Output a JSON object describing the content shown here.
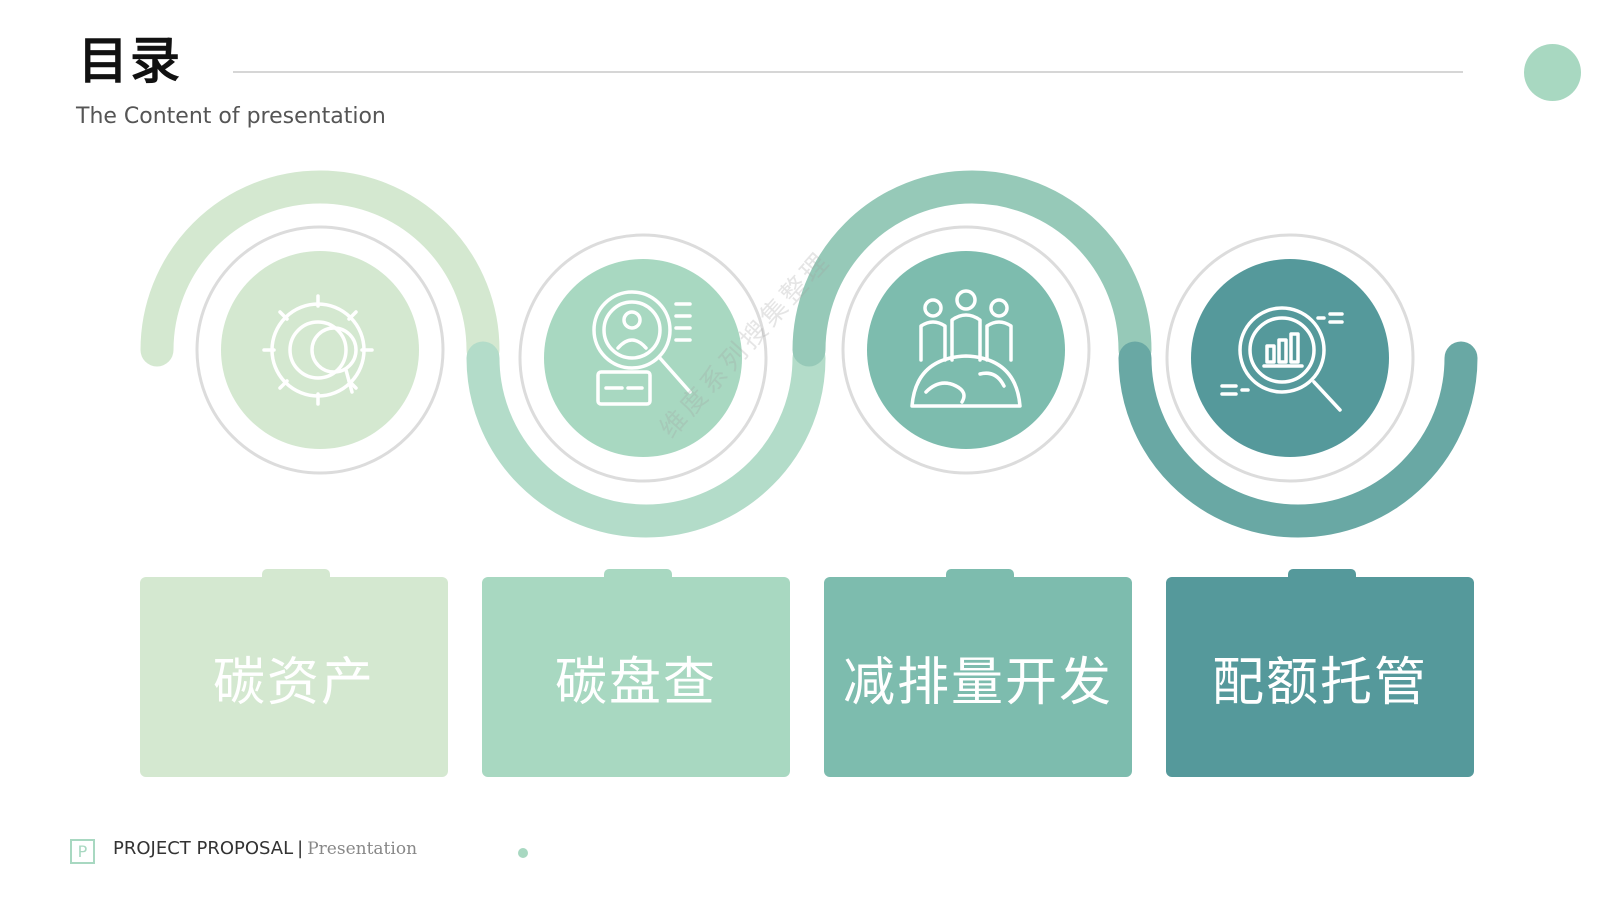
{
  "header": {
    "title": "目录",
    "subtitle": "The Content of presentation"
  },
  "items": [
    {
      "label": "碳资产",
      "icon": "gear-magnifier-icon",
      "color": "#d4e8d0"
    },
    {
      "label": "碳盘查",
      "icon": "person-search-icon",
      "color": "#a8d8c1"
    },
    {
      "label": "减排量开发",
      "icon": "people-globe-icon",
      "color": "#7dbcae"
    },
    {
      "label": "配额托管",
      "icon": "chart-search-icon",
      "color": "#55999b"
    }
  ],
  "footer": {
    "logo_letter": "P",
    "brand": "PROJECT PROPOSAL",
    "separator": "|",
    "tagline": "Presentation"
  },
  "watermark": "维度系列搜集整理",
  "colors": {
    "accent_light": "#d4e8d0",
    "accent_mid": "#a8d8c1",
    "accent_teal": "#7dbcae",
    "accent_dark": "#55999b"
  }
}
